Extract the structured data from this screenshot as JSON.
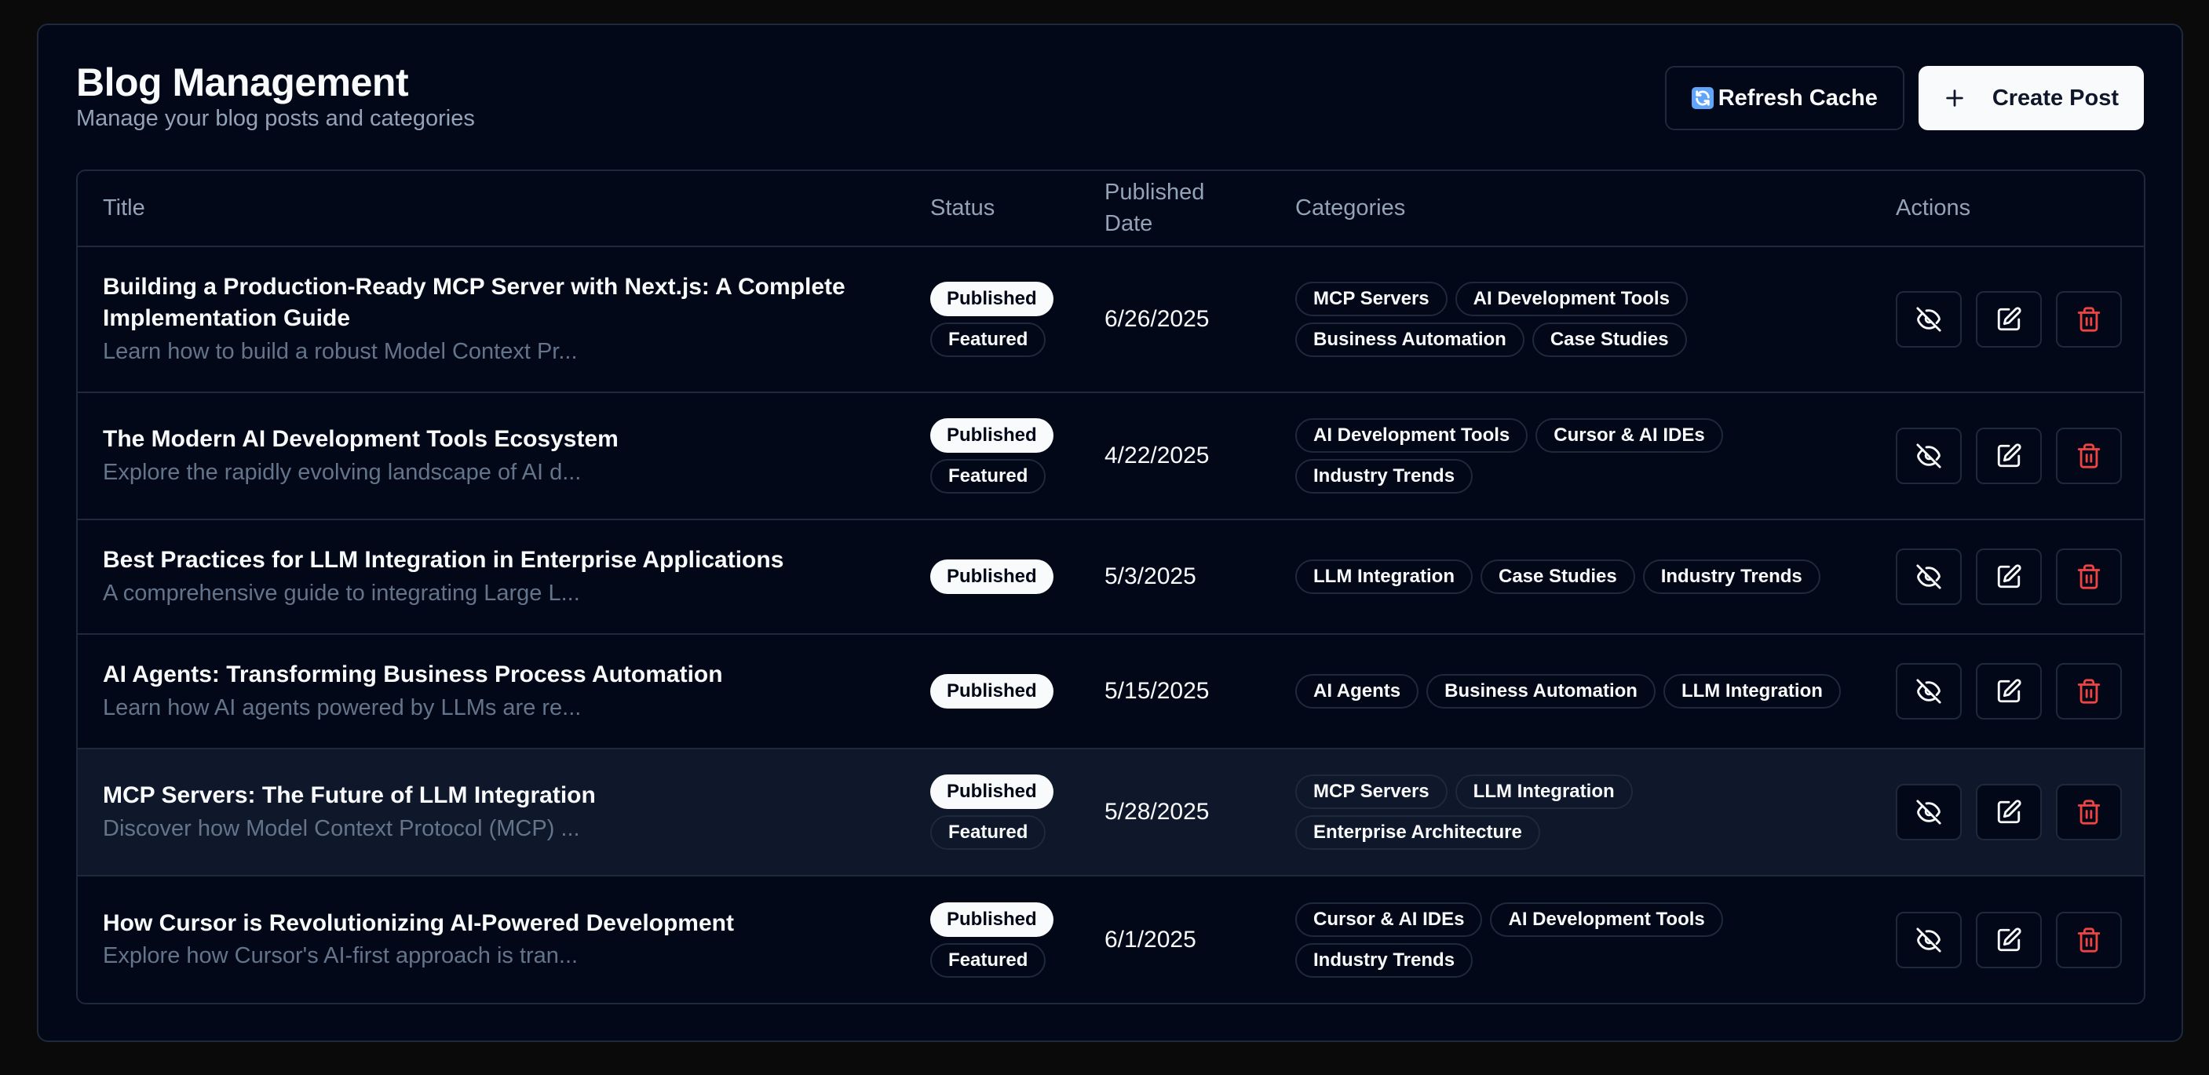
{
  "header": {
    "title": "Blog Management",
    "subtitle": "Manage your blog posts and categories",
    "refresh_label": "Refresh Cache",
    "create_label": "Create Post"
  },
  "table": {
    "columns": [
      "Title",
      "Status",
      "Published Date",
      "Categories",
      "Actions"
    ],
    "rows": [
      {
        "title": "Building a Production-Ready MCP Server with Next.js: A Complete Implementation Guide",
        "excerpt": "Learn how to build a robust Model Context Pr...",
        "status": "Published",
        "featured": "Featured",
        "date": "6/26/2025",
        "categories": [
          "MCP Servers",
          "AI Development Tools",
          "Business Automation",
          "Case Studies"
        ]
      },
      {
        "title": "The Modern AI Development Tools Ecosystem",
        "excerpt": "Explore the rapidly evolving landscape of AI d...",
        "status": "Published",
        "featured": "Featured",
        "date": "4/22/2025",
        "categories": [
          "AI Development Tools",
          "Cursor & AI IDEs",
          "Industry Trends"
        ]
      },
      {
        "title": "Best Practices for LLM Integration in Enterprise Applications",
        "excerpt": "A comprehensive guide to integrating Large L...",
        "status": "Published",
        "featured": "",
        "date": "5/3/2025",
        "categories": [
          "LLM Integration",
          "Case Studies",
          "Industry Trends"
        ]
      },
      {
        "title": "AI Agents: Transforming Business Process Automation",
        "excerpt": "Learn how AI agents powered by LLMs are re...",
        "status": "Published",
        "featured": "",
        "date": "5/15/2025",
        "categories": [
          "AI Agents",
          "Business Automation",
          "LLM Integration"
        ]
      },
      {
        "title": "MCP Servers: The Future of LLM Integration",
        "excerpt": "Discover how Model Context Protocol (MCP) ...",
        "status": "Published",
        "featured": "Featured",
        "date": "5/28/2025",
        "categories": [
          "MCP Servers",
          "LLM Integration",
          "Enterprise Architecture"
        ]
      },
      {
        "title": "How Cursor is Revolutionizing AI-Powered Development",
        "excerpt": "Explore how Cursor's AI-first approach is tran...",
        "status": "Published",
        "featured": "Featured",
        "date": "6/1/2025",
        "categories": [
          "Cursor & AI IDEs",
          "AI Development Tools",
          "Industry Trends"
        ]
      }
    ]
  },
  "icons": {
    "refresh": "refresh-icon",
    "create": "plus-icon",
    "hide": "eye-off-icon",
    "edit": "edit-icon",
    "delete": "trash-icon"
  },
  "colors": {
    "background": "#020817",
    "border": "#1e293b",
    "delete": "#ef4444",
    "highlight_row": "#0f172a"
  }
}
